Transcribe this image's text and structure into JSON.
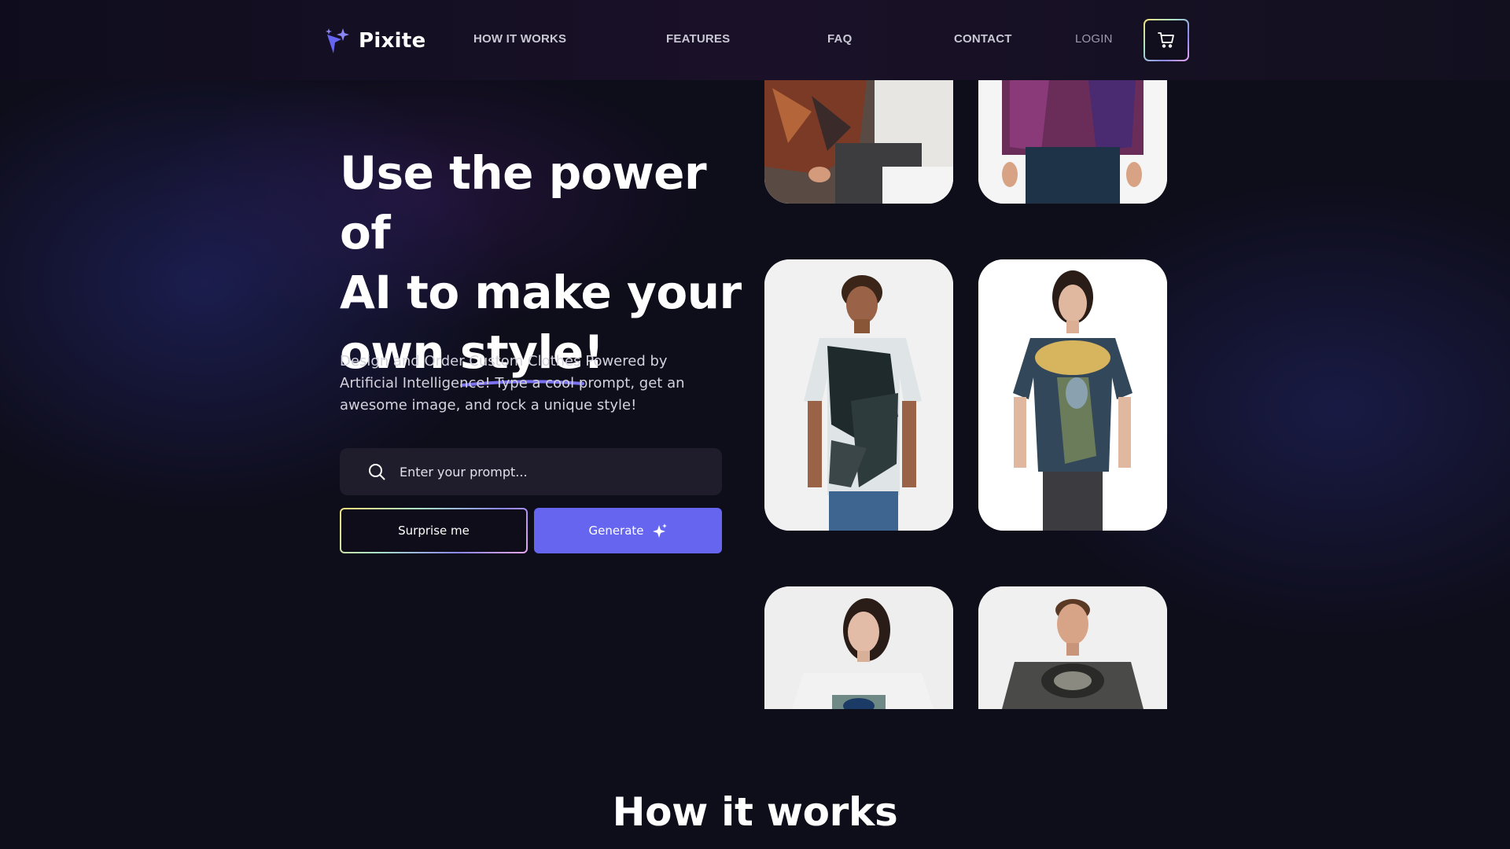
{
  "brand": {
    "name": "Pixite",
    "accent": "#6565f0"
  },
  "nav": {
    "how_it_works": "HOW IT WORKS",
    "features": "FEATURES",
    "faq": "FAQ",
    "contact": "CONTACT",
    "login": "LOGIN",
    "cart_icon": "shopping-cart-icon"
  },
  "hero": {
    "title_line1": "Use the power of",
    "title_line2": "AI to make your",
    "title_line3_prefix": "own ",
    "title_highlight": "style!",
    "description": "Design and Order Custom Clothes Powered by Artificial Intelligence! Type a cool prompt, get an awesome image, and rock a unique style!",
    "prompt_placeholder": "Enter your prompt...",
    "surprise_label": "Surprise me",
    "generate_label": "Generate"
  },
  "gallery": {
    "items": [
      {
        "name": "patterned-shirt-model"
      },
      {
        "name": "purple-jacket-model"
      },
      {
        "name": "tie-dye-tshirt-man"
      },
      {
        "name": "peacock-print-tshirt-woman"
      },
      {
        "name": "white-tshirt-woman"
      },
      {
        "name": "ornate-print-tshirt-man"
      }
    ]
  },
  "sections": {
    "how_it_works_title": "How it works"
  }
}
